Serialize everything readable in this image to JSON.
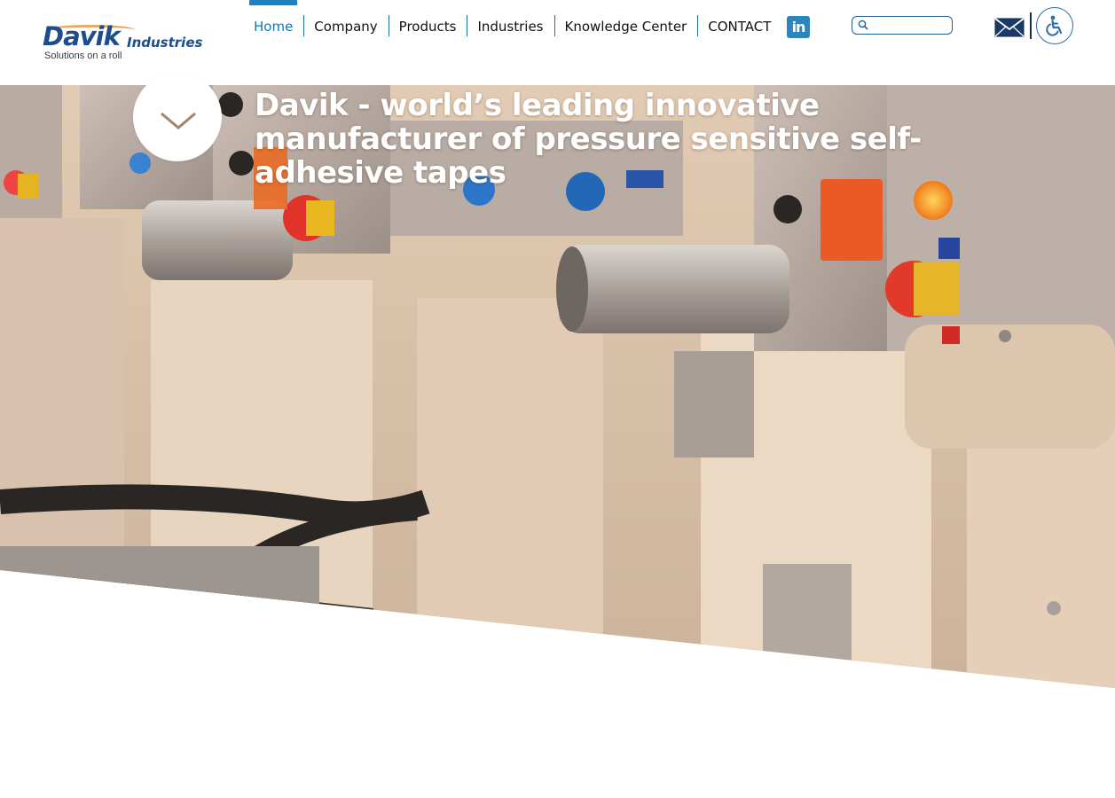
{
  "header": {
    "logo": {
      "name": "Davik",
      "suffix": "Industries",
      "tagline": "Solutions on a roll"
    },
    "nav": [
      {
        "label": "Home",
        "active": true
      },
      {
        "label": "Company",
        "active": false
      },
      {
        "label": "Products",
        "active": false
      },
      {
        "label": "Industries",
        "active": false
      },
      {
        "label": "Knowledge Center",
        "active": false
      },
      {
        "label": "CONTACT",
        "active": false
      }
    ],
    "social": {
      "icon": "linkedin-icon",
      "glyph": "in"
    },
    "search": {
      "placeholder": "",
      "value": ""
    },
    "icons": {
      "mail": "mail-icon",
      "accessibility": "accessibility-icon"
    }
  },
  "hero": {
    "title": "Davik - world’s leading innovative manufacturer of pressure sensitive self-adhesive tapes",
    "scroll_icon": "chevron-down-icon"
  },
  "colors": {
    "accent": "#1a83bf",
    "logo_blue": "#1d4e8a",
    "nav_separator": "#1a6fa6",
    "linkedin": "#2a86bd"
  }
}
